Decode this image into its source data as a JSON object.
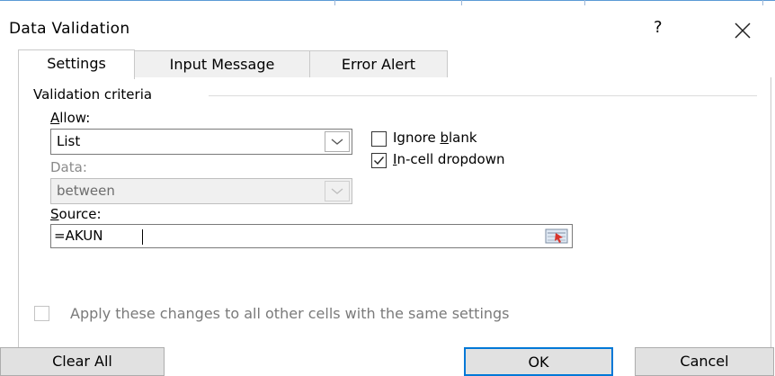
{
  "dialog": {
    "title": "Data Validation",
    "help_label": "?"
  },
  "tabs": [
    {
      "label": "Settings",
      "active": true
    },
    {
      "label": "Input Message",
      "active": false
    },
    {
      "label": "Error Alert",
      "active": false
    }
  ],
  "settings": {
    "group_label": "Validation criteria",
    "allow": {
      "label_mnemonic": "A",
      "label_rest": "llow:",
      "value": "List"
    },
    "data": {
      "label": "Data:",
      "value": "between",
      "disabled": true
    },
    "ignore_blank": {
      "label_before": "Ignore ",
      "label_mnemonic": "b",
      "label_after": "lank",
      "checked": false
    },
    "in_cell_dropdown": {
      "label_mnemonic": "I",
      "label_after": "n-cell dropdown",
      "checked": true
    },
    "source": {
      "label_mnemonic": "S",
      "label_rest": "ource:",
      "value": "=AKUN"
    },
    "apply_all": {
      "label": "Apply these changes to all other cells with the same settings",
      "checked": false,
      "disabled": true
    }
  },
  "buttons": {
    "clear_all": "Clear All",
    "ok": "OK",
    "cancel": "Cancel"
  },
  "colors": {
    "accent": "#0078d7",
    "collapse_icon": "#d9342b"
  },
  "icons": [
    "close-icon",
    "chevron-down-icon",
    "check-icon",
    "collapse-dialog-icon"
  ]
}
